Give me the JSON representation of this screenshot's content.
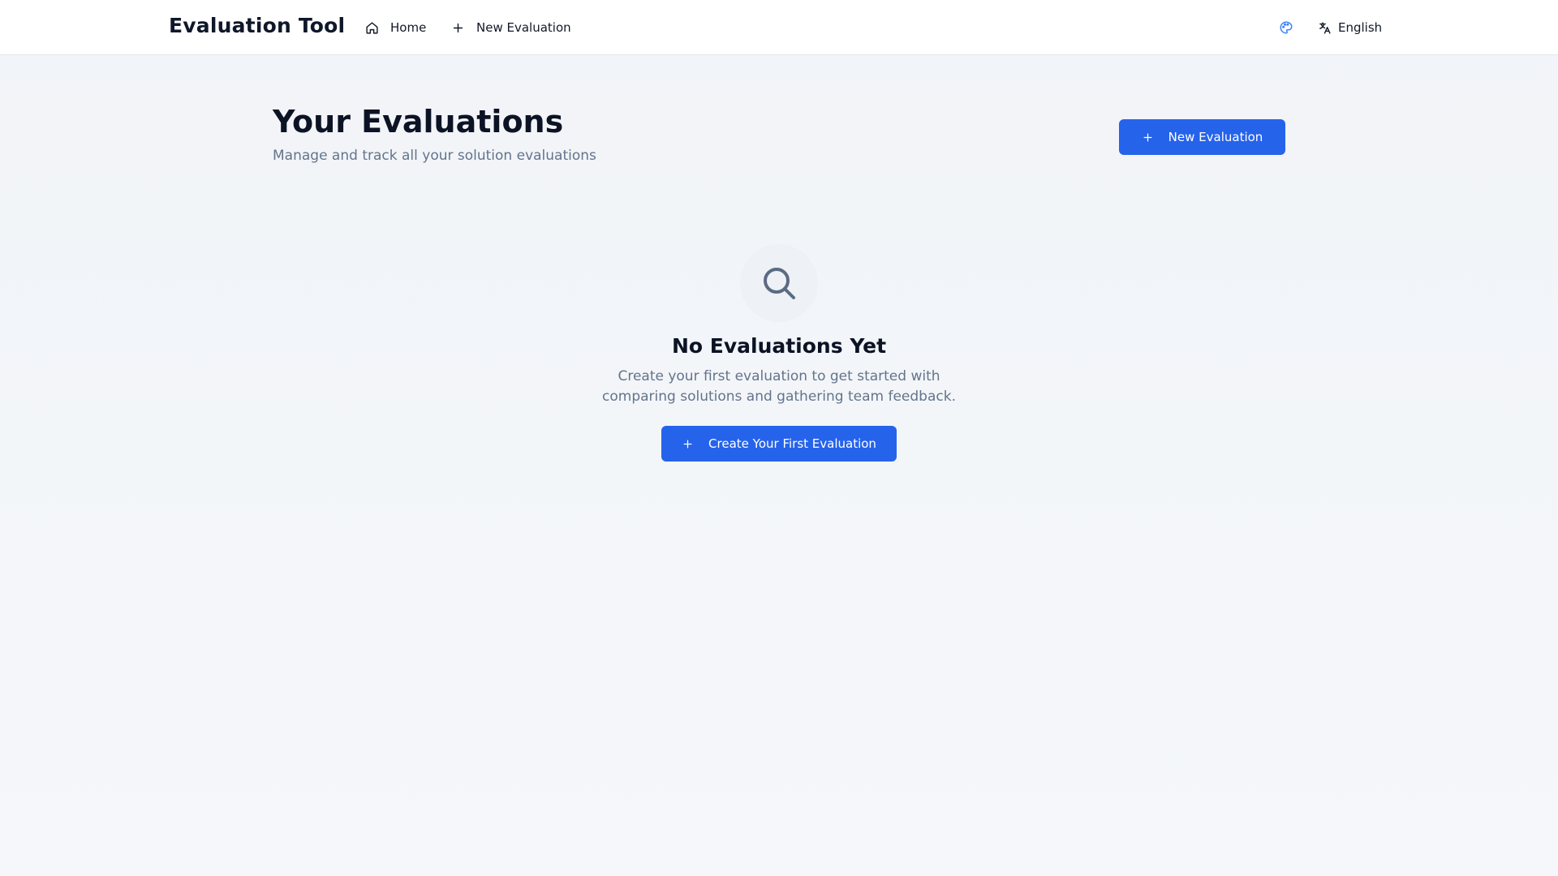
{
  "navbar": {
    "brand": "Evaluation Tool",
    "links": [
      {
        "label": "Home",
        "icon": "home-icon"
      },
      {
        "label": "New Evaluation",
        "icon": "plus-icon"
      }
    ],
    "palette_icon": "palette-icon",
    "language": {
      "label": "English",
      "icon": "translate-icon"
    }
  },
  "header": {
    "title": "Your Evaluations",
    "subtitle": "Manage and track all your solution evaluations",
    "new_button_label": "New Evaluation"
  },
  "empty_state": {
    "icon": "search-icon",
    "title": "No Evaluations Yet",
    "description": "Create your first evaluation to get started with comparing solutions and gathering team feedback.",
    "cta_label": "Create Your First Evaluation"
  },
  "colors": {
    "primary": "#2563eb",
    "accent_icon": "#3b82f6",
    "muted_text": "#64748b",
    "background": "#f3f5f9"
  }
}
